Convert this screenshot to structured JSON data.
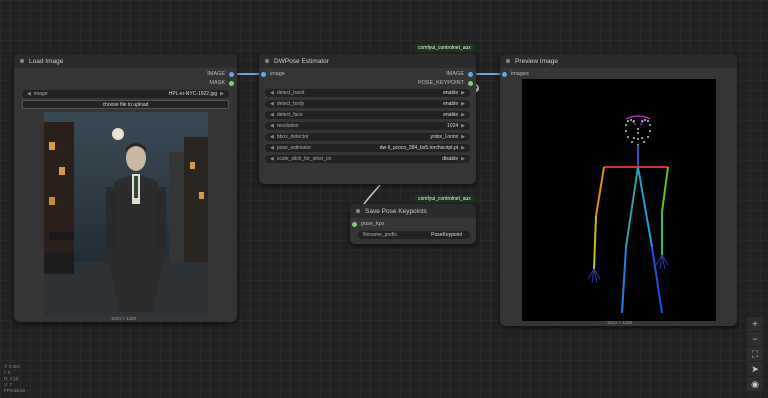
{
  "nodes": {
    "load_image": {
      "title": "Load Image",
      "outputs": [
        "IMAGE",
        "MASK"
      ],
      "widget_label": "image",
      "widget_value": "HPL-in-NYC-1922.jpg",
      "upload_label": "choose file to upload",
      "dims": "1024 × 1280"
    },
    "dwpose": {
      "title": "DWPose Estimator",
      "badge": "comfyui_controlnet_aux",
      "input": "image",
      "outputs": [
        "IMAGE",
        "POSE_KEYPOINT"
      ],
      "widgets": [
        {
          "label": "detect_hand",
          "value": "enable"
        },
        {
          "label": "detect_body",
          "value": "enable"
        },
        {
          "label": "detect_face",
          "value": "enable"
        },
        {
          "label": "resolution",
          "value": "1024"
        },
        {
          "label": "bbox_detector",
          "value": "yolox_l.onnx"
        },
        {
          "label": "pose_estimator",
          "value": "dw-ll_ucoco_384_bs5.torchscript.pt"
        },
        {
          "label": "scale_stick_for_xinsr_cn",
          "value": "disable"
        }
      ]
    },
    "save_pose": {
      "title": "Save Pose Keypoints",
      "badge": "comfyui_controlnet_aux",
      "input": "pose_kps",
      "widget_label": "filename_prefix",
      "widget_value": "PoseKeypoint"
    },
    "preview": {
      "title": "Preview Image",
      "input": "images",
      "dims": "1024 × 1280"
    }
  },
  "toolbar": {
    "icons": [
      "plus-icon",
      "minus-icon",
      "fit-view-icon",
      "navigate-icon",
      "eye-icon"
    ],
    "plus": "+",
    "minus": "−",
    "fit": "⛶",
    "nav": "➤",
    "eye": "◉"
  },
  "stats": [
    "T: 0.00s",
    "I: 0",
    "N: 4 [4]",
    "V: 7",
    "FPS:58.82"
  ],
  "colors": {
    "link_blue": "#6aa6e0",
    "link_green": "#7ecf7e",
    "badge_bg": "#1d3320"
  }
}
